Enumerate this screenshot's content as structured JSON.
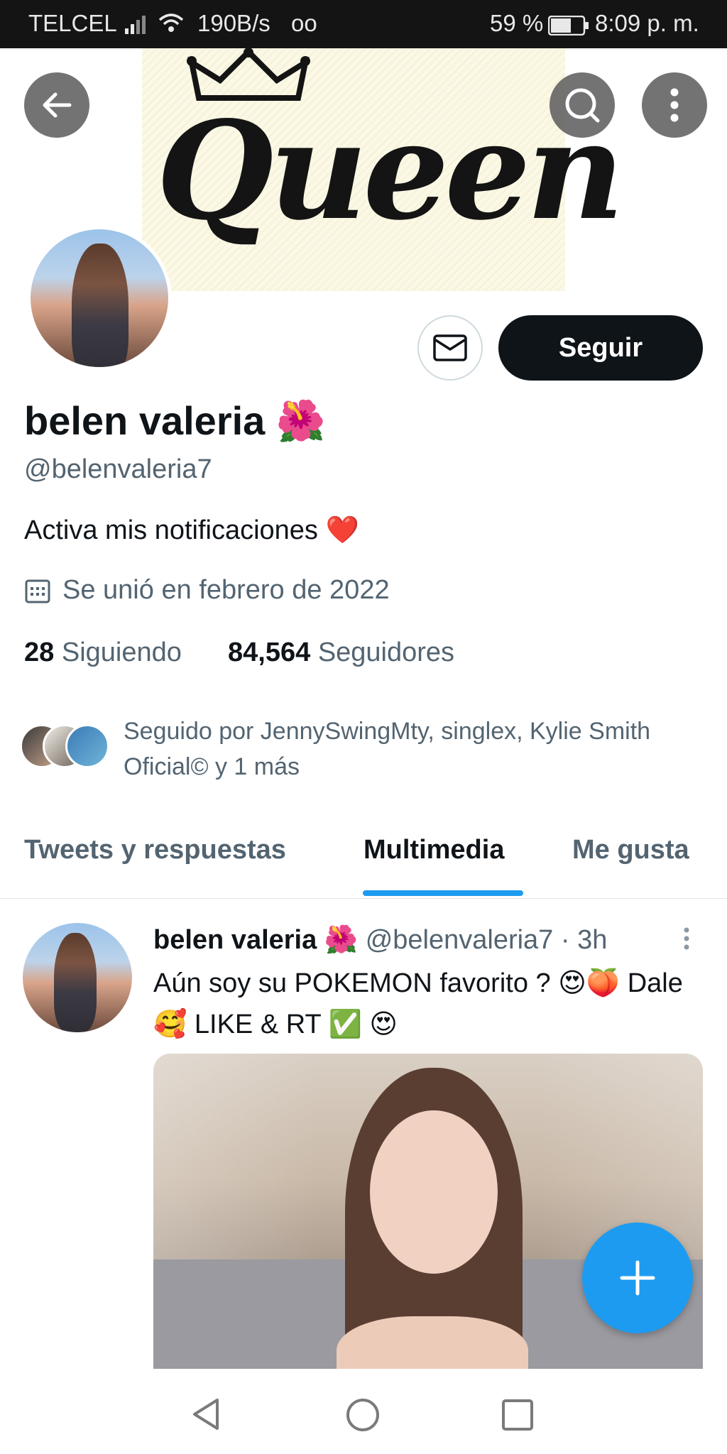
{
  "status_bar": {
    "carrier": "TELCEL",
    "speed": "190B/s",
    "voicemail": "oo",
    "battery": "59 %",
    "time": "8:09 p. m."
  },
  "banner": {
    "art_text": "Queen"
  },
  "header_icons": [
    "arrow-left-icon",
    "search-icon",
    "more-vertical-icon"
  ],
  "profile": {
    "name": "belen valeria 🌺",
    "handle": "@belenvaleria7",
    "bio": "Activa mis notificaciones ❤️",
    "joined": "Se unió en febrero de 2022",
    "following_count": "28",
    "following_label": "Siguiendo",
    "followers_count": "84,564",
    "followers_label": "Seguidores",
    "followed_by": "Seguido por JennySwingMty, singlex, Kylie Smith Oficial© y 1 más",
    "follow_button": "Seguir"
  },
  "tabs": [
    {
      "label": "Tweets y respuestas",
      "active": false
    },
    {
      "label": "Multimedia",
      "active": true
    },
    {
      "label": "Me gusta",
      "active": false
    }
  ],
  "tweet": {
    "name": "belen valeria 🌺",
    "meta": "@belenvaleria7 · 3h",
    "text": "Aún soy su POKEMON favorito ? 😍🍑 Dale 🥰 LIKE & RT ✅ 😍"
  },
  "colors": {
    "accent": "#1d9bf0",
    "text_primary": "#0f1419",
    "text_secondary": "#536471",
    "button_dark": "#0f1419"
  }
}
